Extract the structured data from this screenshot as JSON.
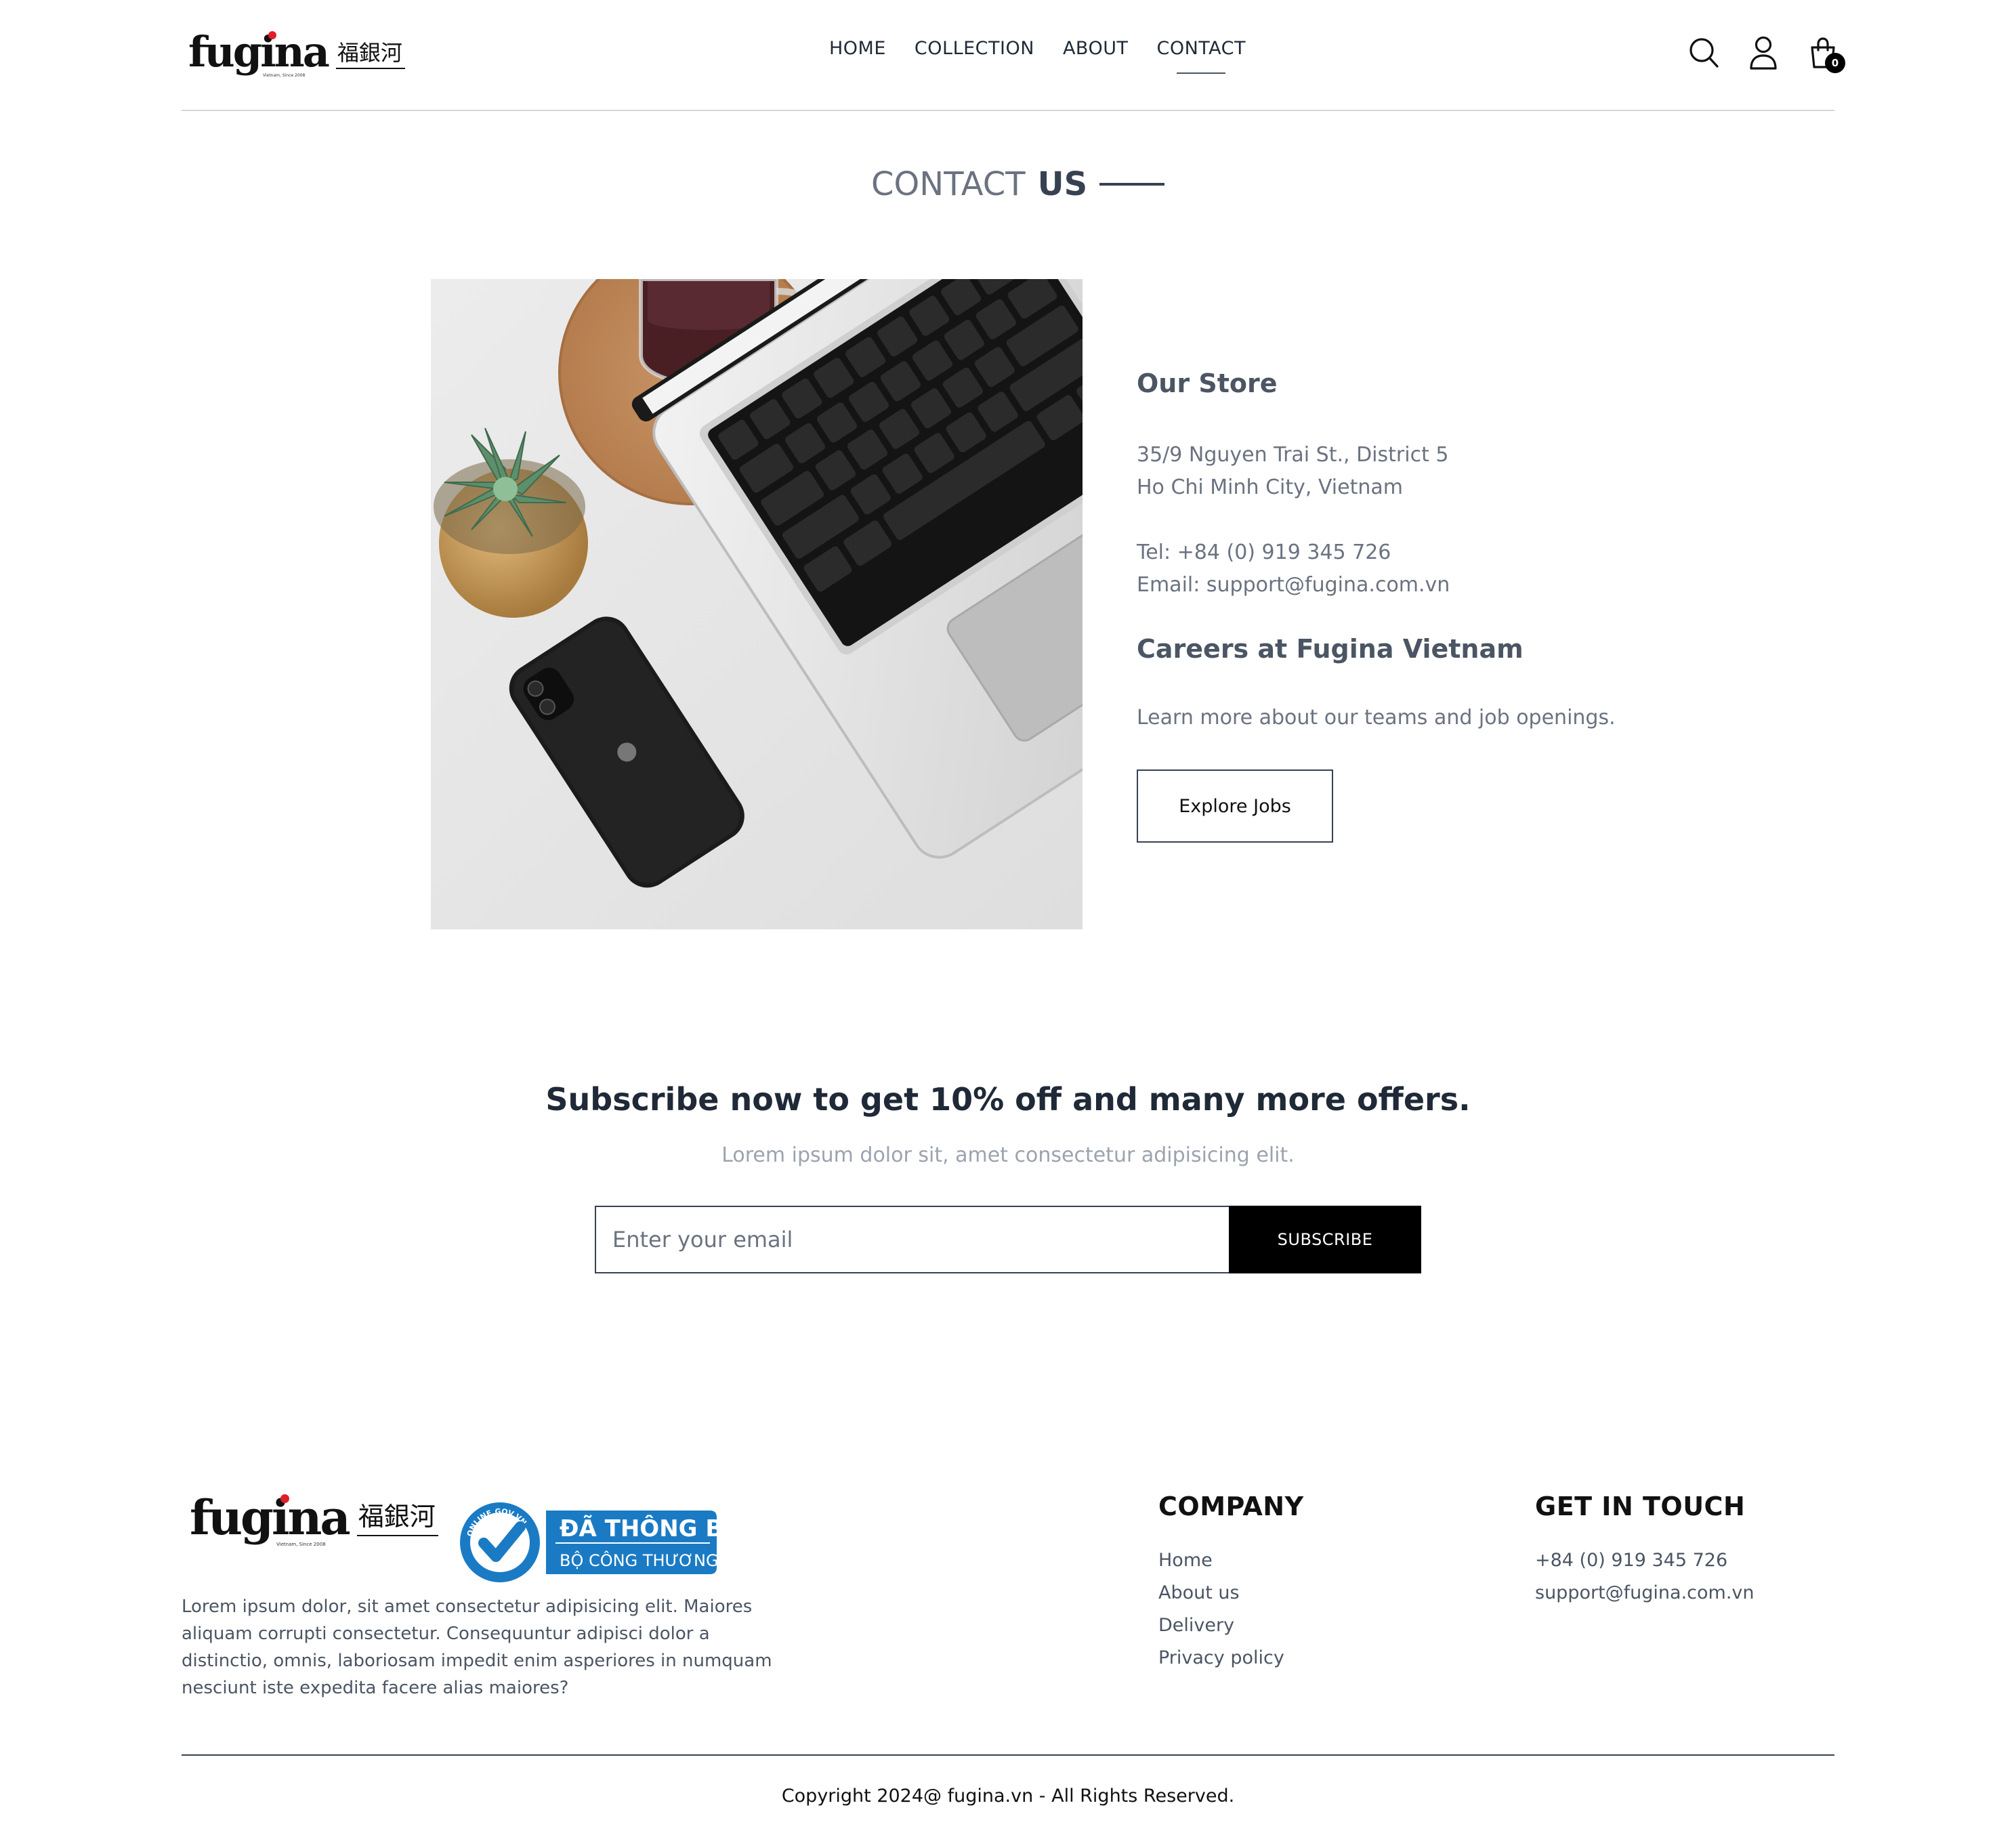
{
  "brand": {
    "wordmark": "fugina",
    "cjk": "福銀河",
    "tagline": "Vietnam, Since 2008"
  },
  "nav": {
    "items": [
      {
        "label": "HOME"
      },
      {
        "label": "COLLECTION"
      },
      {
        "label": "ABOUT"
      },
      {
        "label": "CONTACT"
      }
    ],
    "active": "CONTACT"
  },
  "header_icons": {
    "search": "search-icon",
    "profile": "user-icon",
    "cart": "shopping-bag-icon",
    "cart_count": "0"
  },
  "page_title": {
    "part1": "CONTACT",
    "part2": "US"
  },
  "store": {
    "heading": "Our Store",
    "address_line1": "35/9 Nguyen Trai St., District 5",
    "address_line2": "Ho Chi Minh City, Vietnam",
    "tel": "Tel: +84 (0) 919 345 726",
    "email": "Email: support@fugina.com.vn"
  },
  "careers": {
    "heading": "Careers at Fugina Vietnam",
    "text": "Learn more about our teams and job openings.",
    "button": "Explore Jobs"
  },
  "subscribe": {
    "title": "Subscribe now to get 10% off and many more offers.",
    "text": "Lorem ipsum dolor sit, amet consectetur adipisicing elit.",
    "placeholder": "Enter your email",
    "button": "SUBSCRIBE"
  },
  "footer": {
    "badge_title": "ĐÃ THÔNG BÁO",
    "badge_subtitle": "BỘ CÔNG THƯƠNG",
    "badge_ring": "ONLINE.GOV.VN",
    "description": "Lorem ipsum dolor, sit amet consectetur adipisicing elit. Maiores aliquam corrupti consectetur. Consequuntur adipisci dolor a distinctio, omnis, laboriosam impedit enim asperiores in numquam nesciunt iste expedita facere alias maiores?",
    "company": {
      "heading": "COMPANY",
      "links": [
        {
          "label": "Home"
        },
        {
          "label": "About us"
        },
        {
          "label": "Delivery"
        },
        {
          "label": "Privacy policy"
        }
      ]
    },
    "get_in_touch": {
      "heading": "GET IN TOUCH",
      "phone": "+84 (0) 919 345 726",
      "email": "support@fugina.com.vn"
    },
    "copyright": "Copyright 2024@ fugina.vn - All Rights Reserved."
  },
  "colors": {
    "accent": "#000000",
    "badge_blue": "#1a7bc4",
    "logo_red": "#e11d2a"
  }
}
